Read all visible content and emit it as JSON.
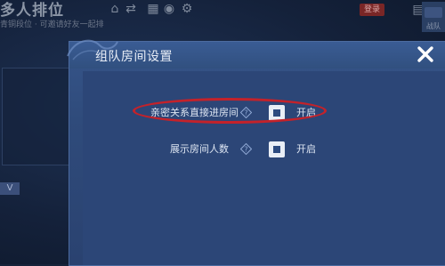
{
  "background": {
    "title": "多人排位",
    "subtitle": "青铜段位 · 可邀请好友一起排",
    "badge": "登录",
    "corner_label": "战队"
  },
  "dialog": {
    "title": "组队房间设置",
    "settings": [
      {
        "label": "亲密关系直接进房间",
        "state": "开启",
        "checked": true,
        "help_icon": "question-diamond-icon"
      },
      {
        "label": "展示房间人数",
        "state": "开启",
        "checked": true,
        "help_icon": "question-diamond-icon"
      }
    ]
  },
  "colors": {
    "dialog_bg": "#2c4677",
    "highlight": "#c4222a",
    "checkbox_bg": "#e9eef6",
    "checkbox_mark": "#2c4a80"
  },
  "icons": {
    "close": "close-icon",
    "help": "question-diamond-icon"
  }
}
